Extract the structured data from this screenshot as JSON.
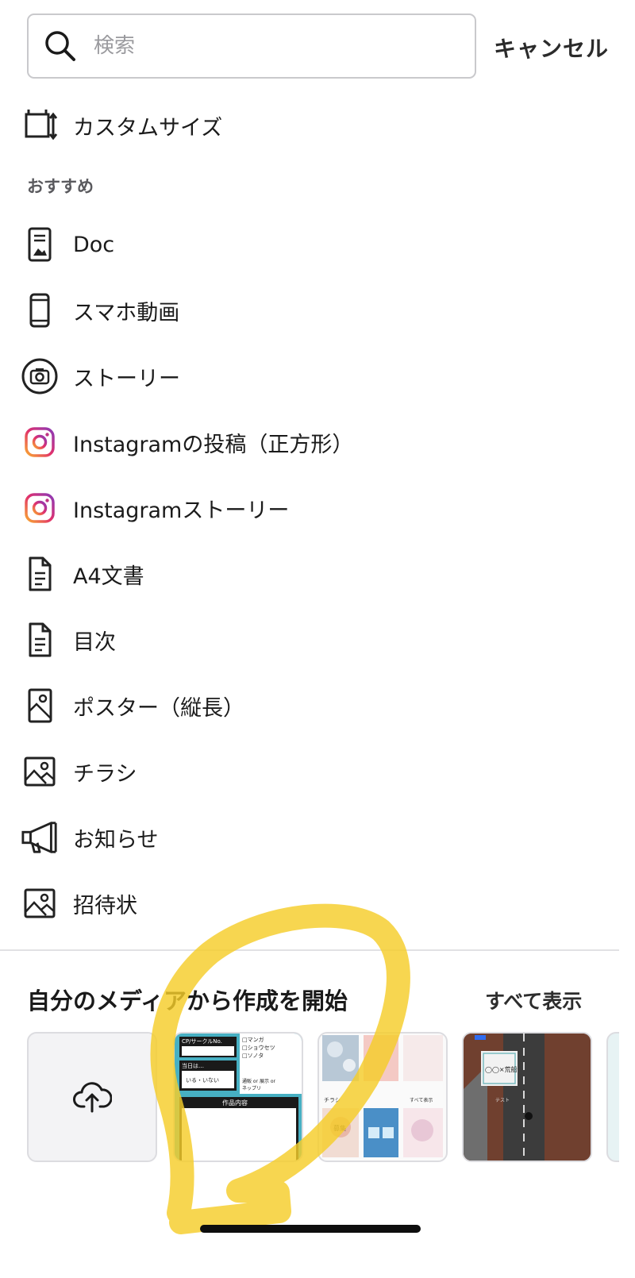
{
  "search": {
    "placeholder": "検索",
    "cancel_label": "キャンセル"
  },
  "custom_size": {
    "label": "カスタムサイズ",
    "icon": "resize-icon"
  },
  "section_title": "おすすめ",
  "items": [
    {
      "label": "Doc",
      "icon": "doc-icon"
    },
    {
      "label": "スマホ動画",
      "icon": "phone-video-icon"
    },
    {
      "label": "ストーリー",
      "icon": "camera-icon"
    },
    {
      "label": "Instagramの投稿（正方形）",
      "icon": "instagram-icon"
    },
    {
      "label": "Instagramストーリー",
      "icon": "instagram-icon"
    },
    {
      "label": "A4文書",
      "icon": "document-icon"
    },
    {
      "label": "目次",
      "icon": "document-icon"
    },
    {
      "label": "ポスター（縦長）",
      "icon": "poster-icon"
    },
    {
      "label": "チラシ",
      "icon": "image-icon"
    },
    {
      "label": "お知らせ",
      "icon": "megaphone-icon"
    },
    {
      "label": "招待状",
      "icon": "image-icon"
    }
  ],
  "media_sheet": {
    "title": "自分のメディアから作成を開始",
    "see_all": "すべて表示",
    "thumb1": {
      "l1": "CP/サークルNo.",
      "l2": "□マンガ",
      "l3": "□ショウセツ",
      "l4": "□ソノタ",
      "l5": "当日は…",
      "l6": "いる・いない",
      "l7": "通販 or 展示 or",
      "l8": "ネップリ",
      "banner": "作品内容"
    },
    "thumb2": {
      "t1": "チラシ",
      "t2": "すべて表示",
      "t3": "募集"
    },
    "thumb3": {
      "t1": "◯◯×荒船",
      "t2": "テスト"
    }
  },
  "colors": {
    "accent_yellow": "#f5cd2a",
    "instagram_pink": "#e1306c",
    "teal": "#47b0c3"
  }
}
